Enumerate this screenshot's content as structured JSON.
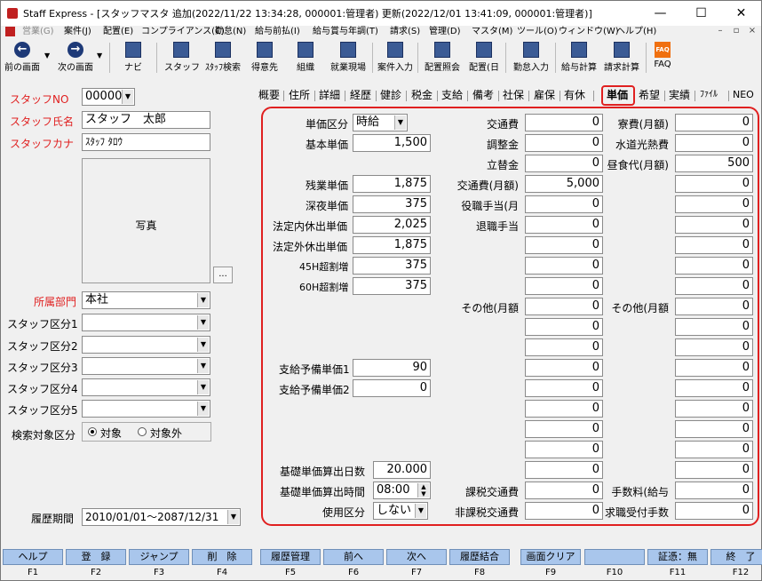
{
  "window": {
    "title": "Staff Express - [スタッフマスタ 追加(2022/11/22 13:34:28, 000001:管理者) 更新(2022/12/01 13:41:09, 000001:管理者)]",
    "min": "—",
    "max": "☐",
    "close": "✕"
  },
  "menu": [
    "営業(G)",
    "案件(J)",
    "配置(E)",
    "コンプライアンス(C)",
    "勤怠(N)",
    "給与前払(I)",
    "給与賞与年調(T)",
    "請求(S)",
    "管理(D)",
    "マスタ(M)",
    "ツール(O)",
    "ウィンドウ(W)",
    "ヘルプ(H)"
  ],
  "mdi": {
    "min": "–",
    "restore": "▫",
    "close": "×"
  },
  "toolbar": {
    "prev": "前の画面",
    "next": "次の画面",
    "navi": "ナビ",
    "staff": "スタッフ",
    "staff_search": "ｽﾀｯﾌ検索",
    "client": "得意先",
    "org": "組織",
    "site": "就業現場",
    "case_input": "案件入力",
    "assign_inquiry": "配置照会",
    "assign_day": "配置(日",
    "attendance": "勤怠入力",
    "pay_calc": "給与計算",
    "bill_calc": "請求計算",
    "faq": "FAQ",
    "faq_icon": "FAQ"
  },
  "left": {
    "staff_no_label": "スタッフNO",
    "staff_no": "000005",
    "name_label": "スタッフ氏名",
    "name": "スタッフ　太郎",
    "kana_label": "スタッフカナ",
    "kana": "ｽﾀｯﾌ ﾀﾛｳ",
    "photo_label": "写真",
    "photo_btn": "...",
    "dept_label": "所属部門",
    "dept": "本社",
    "class1_label": "スタッフ区分1",
    "class2_label": "スタッフ区分2",
    "class3_label": "スタッフ区分3",
    "class4_label": "スタッフ区分4",
    "class5_label": "スタッフ区分5",
    "search_label": "検索対象区分",
    "search_on": "対象",
    "search_off": "対象外",
    "history_label": "履歴期間",
    "history": "2010/01/01～2087/12/31"
  },
  "tabs": [
    "概要",
    "住所",
    "詳細",
    "経歴",
    "健診",
    "税金",
    "支給",
    "備考",
    "社保",
    "雇保",
    "有休",
    "単価",
    "希望",
    "実績",
    "ﾌｧｲﾙ",
    "NEO"
  ],
  "col1": {
    "unit_type_label": "単価区分",
    "unit_type": "時給",
    "base_label": "基本単価",
    "base": "1,500",
    "overtime_label": "残業単価",
    "overtime": "1,875",
    "night_label": "深夜単価",
    "night": "375",
    "legal_in_label": "法定内休出単価",
    "legal_in": "2,025",
    "legal_out_label": "法定外休出単価",
    "legal_out": "1,875",
    "over45_label": "45H超割増",
    "over45": "375",
    "over60_label": "60H超割増",
    "over60": "375",
    "spare1_label": "支給予備単価1",
    "spare1": "90",
    "spare2_label": "支給予備単価2",
    "spare2": "0",
    "days_label": "基礎単価算出日数",
    "days": "20.000",
    "hours_label": "基礎単価算出時間",
    "hours": "08:00",
    "use_label": "使用区分",
    "use": "しない"
  },
  "col2": {
    "labels": [
      "交通費",
      "調整金",
      "立替金",
      "交通費(月額)",
      "役職手当(月",
      "退職手当",
      "",
      "",
      "",
      "その他(月額",
      "",
      "",
      "",
      "",
      "",
      "",
      "",
      "",
      "課税交通費",
      "非課税交通費"
    ],
    "values": [
      "0",
      "0",
      "0",
      "5,000",
      "0",
      "0",
      "0",
      "0",
      "0",
      "0",
      "0",
      "0",
      "0",
      "0",
      "0",
      "0",
      "0",
      "0",
      "0",
      "0"
    ]
  },
  "col3": {
    "labels": [
      "寮費(月額)",
      "水道光熱費",
      "昼食代(月額)",
      "",
      "",
      "",
      "",
      "",
      "",
      "その他(月額",
      "",
      "",
      "",
      "",
      "",
      "",
      "",
      "",
      "手数料(給与",
      "求職受付手数"
    ],
    "values": [
      "0",
      "0",
      "500",
      "0",
      "0",
      "0",
      "0",
      "0",
      "0",
      "0",
      "0",
      "0",
      "0",
      "0",
      "0",
      "0",
      "0",
      "0",
      "0",
      "0"
    ]
  },
  "fkeys": [
    {
      "label": "ヘルプ",
      "key": "F1"
    },
    {
      "label": "登　録",
      "key": "F2"
    },
    {
      "label": "ジャンプ",
      "key": "F3"
    },
    {
      "label": "削　除",
      "key": "F4"
    },
    {
      "label": "履歴管理",
      "key": "F5"
    },
    {
      "label": "前へ",
      "key": "F6"
    },
    {
      "label": "次へ",
      "key": "F7"
    },
    {
      "label": "履歴結合",
      "key": "F8"
    },
    {
      "label": "画面クリア",
      "key": "F9"
    },
    {
      "label": "",
      "key": "F10"
    },
    {
      "label": "証憑：無",
      "key": "F11"
    },
    {
      "label": "終　了",
      "key": "F12"
    }
  ]
}
